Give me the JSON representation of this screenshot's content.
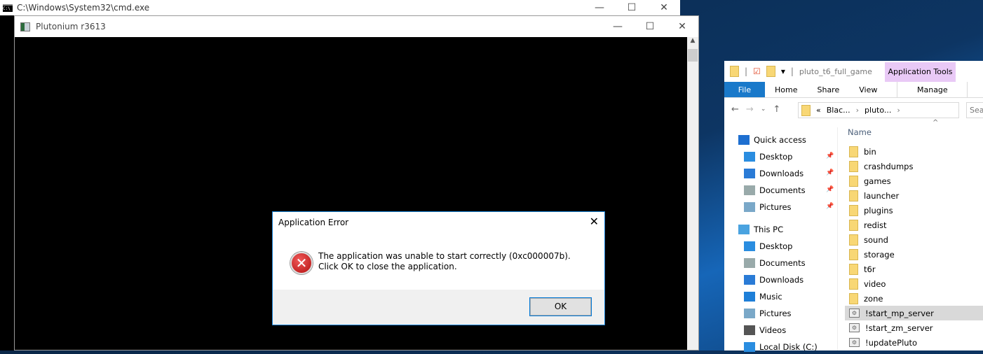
{
  "cmd": {
    "title": "C:\\Windows\\System32\\cmd.exe"
  },
  "pluto": {
    "title": "Plutonium r3613"
  },
  "dialog": {
    "title": "Application Error",
    "message": "The application was unable to start correctly (0xc000007b). Click OK to close the application.",
    "ok": "OK",
    "icon": "error-icon"
  },
  "explorer": {
    "title": "pluto_t6_full_game",
    "context_tab": "Application Tools",
    "tabs": [
      "File",
      "Home",
      "Share",
      "View"
    ],
    "manage": "Manage",
    "breadcrumb": [
      "«",
      "Blac...",
      "pluto..."
    ],
    "search_placeholder": "Sea",
    "column": "Name",
    "nav": [
      {
        "label": "Quick access",
        "icon": "star-icon",
        "color": "#1e6fd0"
      },
      {
        "label": "Desktop",
        "icon": "desktop-icon",
        "color": "#2a8de0",
        "pinned": true
      },
      {
        "label": "Downloads",
        "icon": "download-icon",
        "color": "#2a7bd6",
        "pinned": true
      },
      {
        "label": "Documents",
        "icon": "documents-icon",
        "color": "#9aa",
        "pinned": true
      },
      {
        "label": "Pictures",
        "icon": "pictures-icon",
        "color": "#7aa8c8",
        "pinned": true
      },
      {
        "label": "This PC",
        "icon": "computer-icon",
        "color": "#4aa3e0"
      },
      {
        "label": "Desktop",
        "icon": "desktop-icon",
        "color": "#2a8de0"
      },
      {
        "label": "Documents",
        "icon": "documents-icon",
        "color": "#9aa"
      },
      {
        "label": "Downloads",
        "icon": "download-icon",
        "color": "#2a7bd6"
      },
      {
        "label": "Music",
        "icon": "music-icon",
        "color": "#1e7fd8"
      },
      {
        "label": "Pictures",
        "icon": "pictures-icon",
        "color": "#7aa8c8"
      },
      {
        "label": "Videos",
        "icon": "videos-icon",
        "color": "#555"
      },
      {
        "label": "Local Disk (C:)",
        "icon": "disk-icon",
        "color": "#2a8de0"
      }
    ],
    "files": [
      {
        "name": "bin",
        "type": "folder"
      },
      {
        "name": "crashdumps",
        "type": "folder"
      },
      {
        "name": "games",
        "type": "folder"
      },
      {
        "name": "launcher",
        "type": "folder"
      },
      {
        "name": "plugins",
        "type": "folder"
      },
      {
        "name": "redist",
        "type": "folder"
      },
      {
        "name": "sound",
        "type": "folder"
      },
      {
        "name": "storage",
        "type": "folder"
      },
      {
        "name": "t6r",
        "type": "folder"
      },
      {
        "name": "video",
        "type": "folder"
      },
      {
        "name": "zone",
        "type": "folder"
      },
      {
        "name": "!start_mp_server",
        "type": "batch",
        "selected": true
      },
      {
        "name": "!start_zm_server",
        "type": "batch"
      },
      {
        "name": "!updatePluto",
        "type": "batch"
      }
    ]
  }
}
